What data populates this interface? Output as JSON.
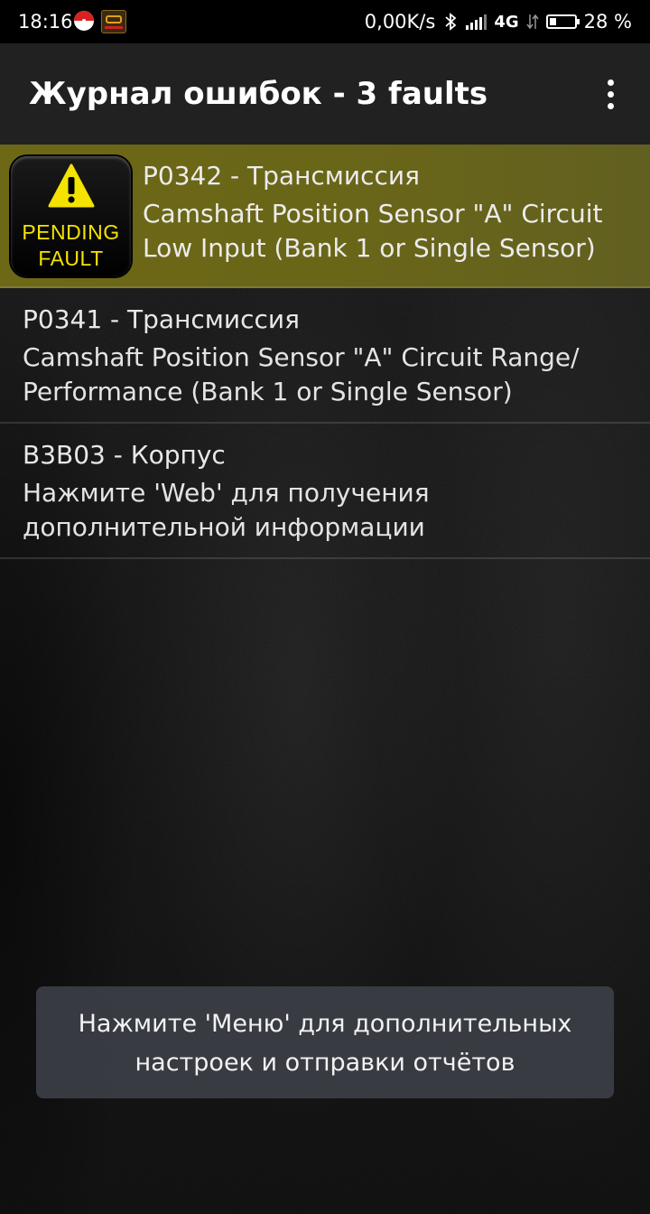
{
  "status_bar": {
    "time": "18:16",
    "net_speed": "0,00K/s",
    "network": "4G",
    "battery_text": "28 %",
    "battery_level": 0.28
  },
  "app_bar": {
    "title": "Журнал ошибок - 3 faults"
  },
  "faults": [
    {
      "badge_line1": "PENDING",
      "badge_line2": "FAULT",
      "code": "P0342 - Трансмиссия",
      "description": "Camshaft Position Sensor \"A\" Circuit Low Input (Bank 1 or Single Sensor)"
    },
    {
      "code": "P0341 - Трансмиссия",
      "description": "Camshaft Position Sensor \"A\" Circuit Range/ Performance (Bank 1 or Single Sensor)"
    },
    {
      "code": "B3B03 - Корпус",
      "description": "Нажмите 'Web' для получения дополнительной информации"
    }
  ],
  "toast": {
    "line1": "Нажмите 'Меню' для дополнительных",
    "line2": "настроек и отправки отчётов"
  },
  "colors": {
    "selected_row": "#6a6618",
    "badge_text": "#f4e300",
    "warning_triangle": "#f4e300"
  }
}
